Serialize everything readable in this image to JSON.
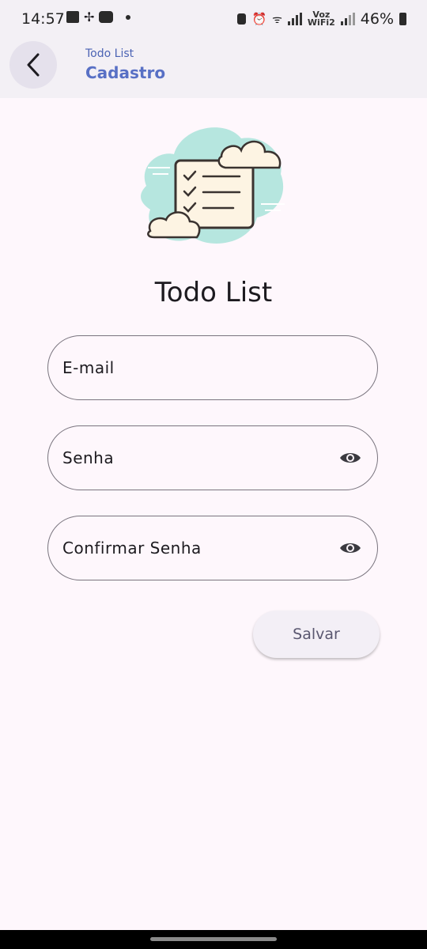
{
  "status_bar": {
    "time": "14:57",
    "voice_label_top": "Voz",
    "voice_label_bottom": "WiFi2",
    "battery_percent": "46%"
  },
  "header": {
    "overline": "Todo List",
    "title": "Cadastro"
  },
  "main": {
    "app_title": "Todo List",
    "email_placeholder": "E-mail",
    "password_placeholder": "Senha",
    "confirm_password_placeholder": "Confirmar Senha",
    "save_label": "Salvar"
  },
  "colors": {
    "accent": "#5870c5",
    "background": "#fef7fc",
    "outline": "#79747e",
    "illustration_bg": "#b6e6df"
  }
}
